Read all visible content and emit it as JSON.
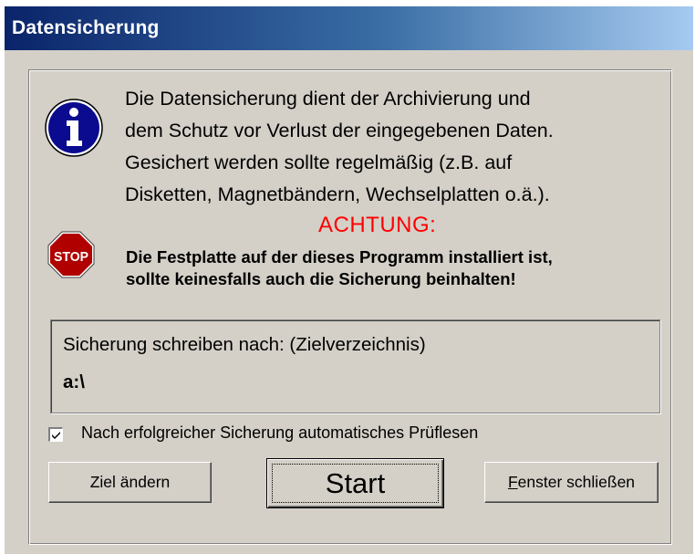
{
  "window": {
    "title": "Datensicherung"
  },
  "info": {
    "icon": "info-icon",
    "lines": [
      "Die Datensicherung dient der Archivierung und",
      "dem Schutz vor Verlust der eingegebenen Daten.",
      "Gesichert werden sollte regelmäßig (z.B. auf",
      "Disketten, Magnetbändern, Wechselplatten o.ä.)."
    ]
  },
  "warning": {
    "icon": "stop-icon",
    "stop_text": "STOP",
    "title": "ACHTUNG:",
    "title_color": "#ff0000",
    "lines": [
      "Die Festplatte auf der dieses Programm installiert ist,",
      "sollte keinesfalls auch die Sicherung beinhalten!"
    ]
  },
  "target": {
    "label": "Sicherung schreiben nach: (Zielverzeichnis)",
    "value": "a:\\"
  },
  "verify": {
    "label": "Nach erfolgreicher Sicherung automatisches Prüflesen",
    "checked": true
  },
  "buttons": {
    "change_target": "Ziel ändern",
    "start": "Start",
    "close_first": "F",
    "close_rest": "enster schließen"
  },
  "colors": {
    "titlebar_start": "#0a246a",
    "titlebar_end": "#a6caf0",
    "face": "#d4d0c8",
    "stop_red": "#b00000"
  }
}
